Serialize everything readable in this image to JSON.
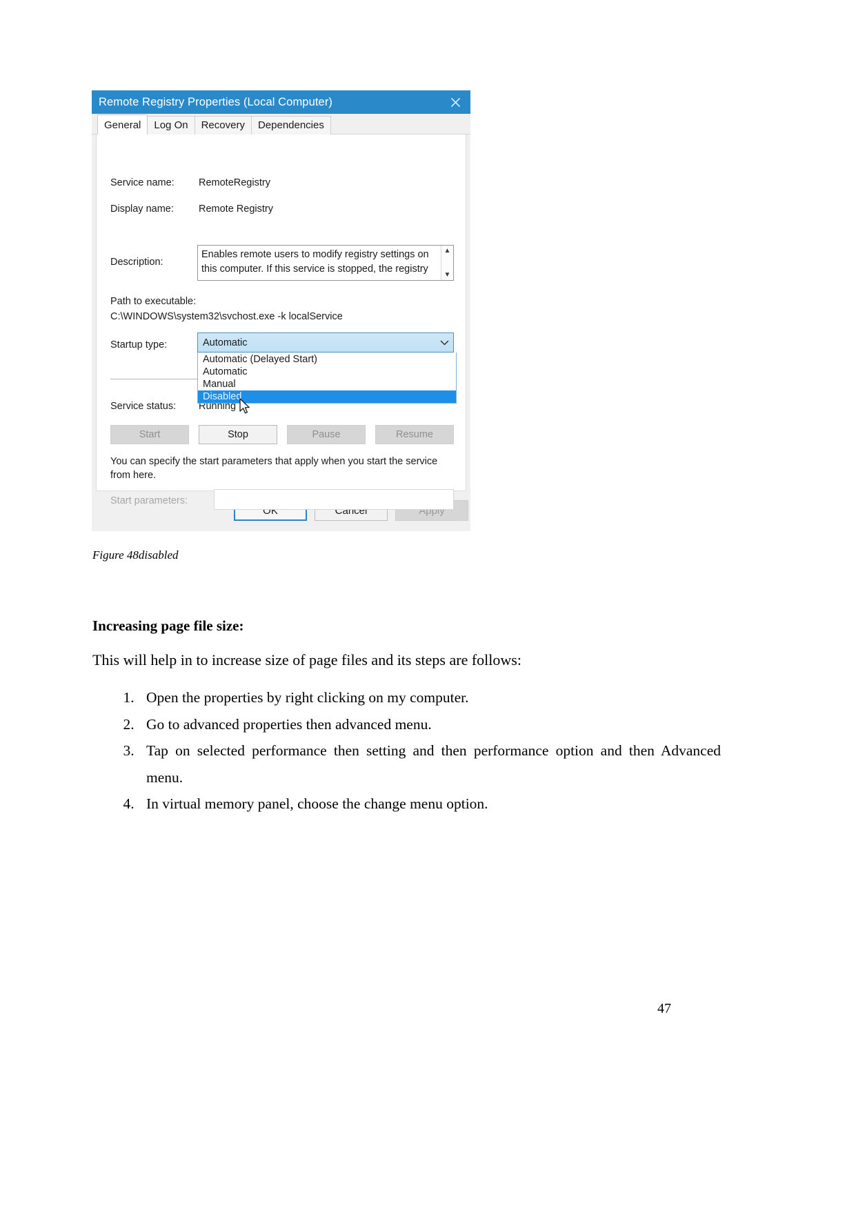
{
  "dialog": {
    "title": "Remote Registry Properties (Local Computer)",
    "close_icon": "close-icon",
    "tabs": [
      {
        "label": "General",
        "active": true
      },
      {
        "label": "Log On",
        "active": false
      },
      {
        "label": "Recovery",
        "active": false
      },
      {
        "label": "Dependencies",
        "active": false
      }
    ],
    "fields": {
      "service_name_label": "Service name:",
      "service_name_value": "RemoteRegistry",
      "display_name_label": "Display name:",
      "display_name_value": "Remote Registry",
      "description_label": "Description:",
      "description_value": "Enables remote users to modify registry settings on this computer. If this service is stopped, the registry",
      "path_label": "Path to executable:",
      "path_value": "C:\\WINDOWS\\system32\\svchost.exe -k localService",
      "startup_type_label": "Startup type:",
      "startup_type_value": "Automatic",
      "service_status_label": "Service status:",
      "service_status_value": "Running",
      "start_parameters_label": "Start parameters:",
      "start_parameters_value": "",
      "start_parameters_placeholder": ""
    },
    "startup_options": [
      {
        "label": "Automatic (Delayed Start)",
        "selected": false
      },
      {
        "label": "Automatic",
        "selected": false
      },
      {
        "label": "Manual",
        "selected": false
      },
      {
        "label": "Disabled",
        "selected": true
      }
    ],
    "service_buttons": [
      {
        "label": "Start",
        "enabled": false
      },
      {
        "label": "Stop",
        "enabled": true
      },
      {
        "label": "Pause",
        "enabled": false
      },
      {
        "label": "Resume",
        "enabled": false
      }
    ],
    "help_text": "You can specify the start parameters that apply when you start the service from here.",
    "footer_buttons": [
      {
        "label": "OK",
        "style": "default"
      },
      {
        "label": "Cancel",
        "style": "normal"
      },
      {
        "label": "Apply",
        "style": "disabled"
      }
    ],
    "colors": {
      "titlebar": "#2a8ac9",
      "selection": "#1d8fe8",
      "combo_highlight": "#cfe8f7",
      "default_button_border": "#2a84c4"
    }
  },
  "document": {
    "figure_caption": "Figure 48disabled",
    "heading": "Increasing page file size:",
    "paragraph": "This will help in to increase size of page files and its steps are follows:",
    "steps": [
      "Open the properties by right clicking on my computer.",
      "Go to advanced properties then advanced menu.",
      "Tap on selected performance then setting and then performance option and then Advanced menu.",
      "In virtual memory panel, choose the change menu option."
    ],
    "page_number": "47"
  }
}
